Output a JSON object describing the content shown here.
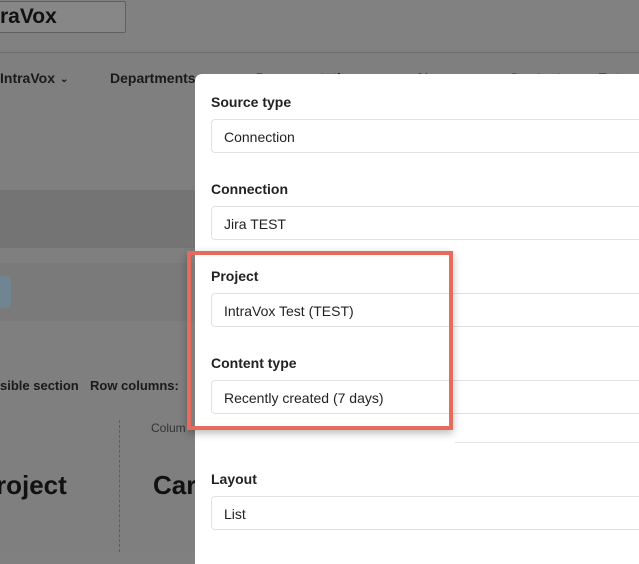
{
  "app": {
    "logo_text": "traVox"
  },
  "nav": {
    "items": [
      {
        "label": "IntraVox"
      },
      {
        "label": "Departments"
      },
      {
        "label": "Documentation"
      },
      {
        "label": "News"
      },
      {
        "label": "Contacts"
      },
      {
        "label": "Extra"
      }
    ]
  },
  "background": {
    "visible_section_label": "sible section",
    "row_columns_label": "Row columns:",
    "column_label": "Colum",
    "heading_left": "roject",
    "heading_right": "Car"
  },
  "modal": {
    "fields": [
      {
        "label": "Source type",
        "value": "Connection"
      },
      {
        "label": "Connection",
        "value": "Jira TEST"
      },
      {
        "label": "Project",
        "value": "IntraVox Test (TEST)"
      },
      {
        "label": "Content type",
        "value": "Recently created (7 days)"
      },
      {
        "label": "Layout",
        "value": "List"
      }
    ]
  },
  "colors": {
    "highlight_border": "#e76a5e",
    "overlay": "#7f7f7f",
    "modal_bg": "#ffffff"
  }
}
